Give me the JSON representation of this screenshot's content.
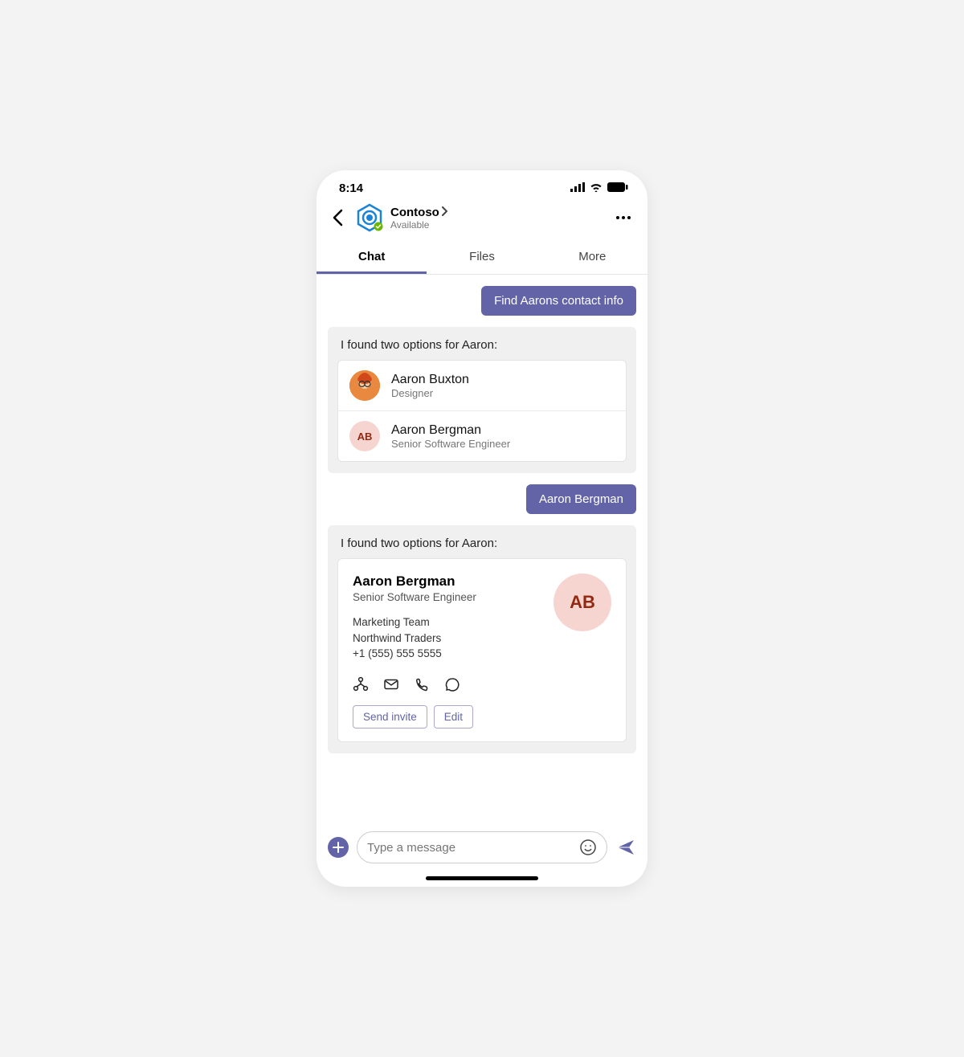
{
  "status": {
    "time": "8:14"
  },
  "header": {
    "title": "Contoso",
    "subtitle": "Available"
  },
  "tabs": [
    "Chat",
    "Files",
    "More"
  ],
  "active_tab": 0,
  "messages": {
    "user1": "Find Aarons contact info",
    "bot1_intro": "I found two options for Aaron:",
    "options": [
      {
        "name": "Aaron Buxton",
        "role": "Designer",
        "initials": ""
      },
      {
        "name": "Aaron Bergman",
        "role": "Senior Software Engineer",
        "initials": "AB"
      }
    ],
    "user2": "Aaron Bergman",
    "bot2_intro": "I found two options for Aaron:",
    "contact": {
      "name": "Aaron Bergman",
      "role": "Senior Software Engineer",
      "team": "Marketing Team",
      "company": "Northwind Traders",
      "phone": "+1 (555) 555 5555",
      "initials": "AB",
      "actions": {
        "invite": "Send invite",
        "edit": "Edit"
      }
    }
  },
  "composer": {
    "placeholder": "Type a message"
  }
}
